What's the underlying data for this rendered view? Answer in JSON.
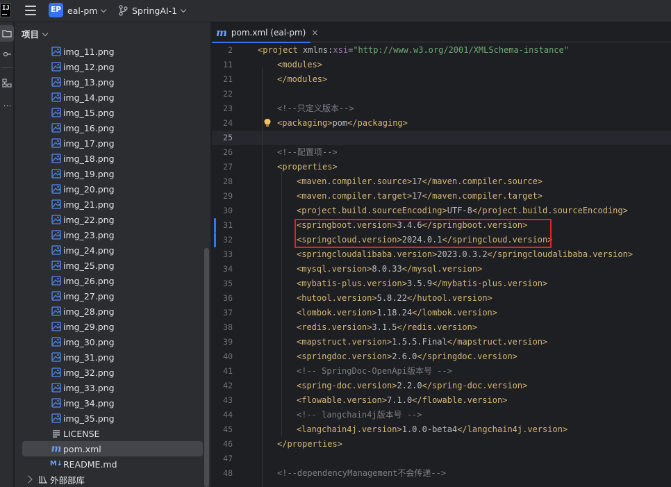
{
  "titlebar": {
    "logo_text": "IJ",
    "project_badge": "EP",
    "project_name": "eal-pm",
    "branch_name": "SpringAI-1"
  },
  "project_panel": {
    "header": "项目",
    "items": [
      {
        "label": "img_11.png",
        "type": "image"
      },
      {
        "label": "img_12.png",
        "type": "image"
      },
      {
        "label": "img_13.png",
        "type": "image"
      },
      {
        "label": "img_14.png",
        "type": "image"
      },
      {
        "label": "img_15.png",
        "type": "image"
      },
      {
        "label": "img_16.png",
        "type": "image"
      },
      {
        "label": "img_17.png",
        "type": "image"
      },
      {
        "label": "img_18.png",
        "type": "image"
      },
      {
        "label": "img_19.png",
        "type": "image"
      },
      {
        "label": "img_20.png",
        "type": "image"
      },
      {
        "label": "img_21.png",
        "type": "image"
      },
      {
        "label": "img_22.png",
        "type": "image"
      },
      {
        "label": "img_23.png",
        "type": "image"
      },
      {
        "label": "img_24.png",
        "type": "image"
      },
      {
        "label": "img_25.png",
        "type": "image"
      },
      {
        "label": "img_26.png",
        "type": "image"
      },
      {
        "label": "img_27.png",
        "type": "image"
      },
      {
        "label": "img_28.png",
        "type": "image"
      },
      {
        "label": "img_29.png",
        "type": "image"
      },
      {
        "label": "img_30.png",
        "type": "image"
      },
      {
        "label": "img_31.png",
        "type": "image"
      },
      {
        "label": "img_32.png",
        "type": "image"
      },
      {
        "label": "img_33.png",
        "type": "image"
      },
      {
        "label": "img_34.png",
        "type": "image"
      },
      {
        "label": "img_35.png",
        "type": "image"
      },
      {
        "label": "LICENSE",
        "type": "text"
      },
      {
        "label": "pom.xml",
        "type": "maven",
        "selected": true
      },
      {
        "label": "README.md",
        "type": "markdown"
      }
    ],
    "external_libraries": "外部部库"
  },
  "editor": {
    "tab_label": "pom.xml (eal-pm)",
    "tab_close": "×",
    "lines": [
      {
        "num": "2",
        "parts": [
          [
            "tag",
            "<project "
          ],
          [
            "attr",
            "xmlns:"
          ],
          [
            "ns",
            "xsi"
          ],
          [
            "attr",
            "="
          ],
          [
            "str",
            "\"http://www.w3.org/2001/XMLSchema-instance\""
          ]
        ],
        "indent": 0
      },
      {
        "num": "11",
        "parts": [
          [
            "tag",
            "<modules>"
          ]
        ],
        "indent": 1
      },
      {
        "num": "21",
        "parts": [
          [
            "tag",
            "</modules>"
          ]
        ],
        "indent": 1
      },
      {
        "num": "22",
        "parts": [],
        "indent": 0
      },
      {
        "num": "23",
        "parts": [
          [
            "cmt",
            "<!--只定义版本-->"
          ]
        ],
        "indent": 1
      },
      {
        "num": "24",
        "parts": [
          [
            "tag",
            "<packaging>"
          ],
          [
            "txt",
            "pom"
          ],
          [
            "tag",
            "</packaging>"
          ]
        ],
        "indent": 1,
        "bulb": true
      },
      {
        "num": "25",
        "parts": [],
        "indent": 0,
        "current": true
      },
      {
        "num": "26",
        "parts": [
          [
            "cmt",
            "<!--配置项-->"
          ]
        ],
        "indent": 1
      },
      {
        "num": "27",
        "parts": [
          [
            "tag",
            "<properties>"
          ]
        ],
        "indent": 1
      },
      {
        "num": "28",
        "parts": [
          [
            "tag",
            "<maven.compiler.source>"
          ],
          [
            "txt",
            "17"
          ],
          [
            "tag",
            "</maven.compiler.source>"
          ]
        ],
        "indent": 2
      },
      {
        "num": "29",
        "parts": [
          [
            "tag",
            "<maven.compiler.target>"
          ],
          [
            "txt",
            "17"
          ],
          [
            "tag",
            "</maven.compiler.target>"
          ]
        ],
        "indent": 2
      },
      {
        "num": "30",
        "parts": [
          [
            "tag",
            "<project.build.sourceEncoding>"
          ],
          [
            "txt",
            "UTF-8"
          ],
          [
            "tag",
            "</project.build.sourceEncoding>"
          ]
        ],
        "indent": 2
      },
      {
        "num": "31",
        "parts": [
          [
            "tag",
            "<springboot.version>"
          ],
          [
            "txt",
            "3.4.6"
          ],
          [
            "tag",
            "</springboot.version>"
          ]
        ],
        "indent": 2,
        "changed": true
      },
      {
        "num": "32",
        "parts": [
          [
            "tag",
            "<springcloud.version>"
          ],
          [
            "txt",
            "2024.0.1"
          ],
          [
            "tag",
            "</springcloud.version>"
          ]
        ],
        "indent": 2,
        "changed": true
      },
      {
        "num": "33",
        "parts": [
          [
            "tag",
            "<springcloudalibaba.version>"
          ],
          [
            "txt",
            "2023.0.3.2"
          ],
          [
            "tag",
            "</springcloudalibaba.version>"
          ]
        ],
        "indent": 2
      },
      {
        "num": "34",
        "parts": [
          [
            "tag",
            "<mysql.version>"
          ],
          [
            "txt",
            "8.0.33"
          ],
          [
            "tag",
            "</mysql.version>"
          ]
        ],
        "indent": 2
      },
      {
        "num": "35",
        "parts": [
          [
            "tag",
            "<mybatis-plus.version>"
          ],
          [
            "txt",
            "3.5.9"
          ],
          [
            "tag",
            "</mybatis-plus.version>"
          ]
        ],
        "indent": 2
      },
      {
        "num": "36",
        "parts": [
          [
            "tag",
            "<hutool.version>"
          ],
          [
            "txt",
            "5.8.22"
          ],
          [
            "tag",
            "</hutool.version>"
          ]
        ],
        "indent": 2
      },
      {
        "num": "37",
        "parts": [
          [
            "tag",
            "<lombok.version>"
          ],
          [
            "txt",
            "1.18.24"
          ],
          [
            "tag",
            "</lombok.version>"
          ]
        ],
        "indent": 2
      },
      {
        "num": "38",
        "parts": [
          [
            "tag",
            "<redis.version>"
          ],
          [
            "txt",
            "3.1.5"
          ],
          [
            "tag",
            "</redis.version>"
          ]
        ],
        "indent": 2
      },
      {
        "num": "39",
        "parts": [
          [
            "tag",
            "<mapstruct.version>"
          ],
          [
            "txt",
            "1.5.5.Final"
          ],
          [
            "tag",
            "</mapstruct.version>"
          ]
        ],
        "indent": 2
      },
      {
        "num": "40",
        "parts": [
          [
            "tag",
            "<springdoc.version>"
          ],
          [
            "txt",
            "2.6.0"
          ],
          [
            "tag",
            "</springdoc.version>"
          ]
        ],
        "indent": 2
      },
      {
        "num": "41",
        "parts": [
          [
            "cmt",
            "<!-- SpringDoc-OpenApi版本号 -->"
          ]
        ],
        "indent": 2
      },
      {
        "num": "42",
        "parts": [
          [
            "tag",
            "<spring-doc.version>"
          ],
          [
            "txt",
            "2.2.0"
          ],
          [
            "tag",
            "</spring-doc.version>"
          ]
        ],
        "indent": 2
      },
      {
        "num": "43",
        "parts": [
          [
            "tag",
            "<flowable.version>"
          ],
          [
            "txt",
            "7.1.0"
          ],
          [
            "tag",
            "</flowable.version>"
          ]
        ],
        "indent": 2
      },
      {
        "num": "44",
        "parts": [
          [
            "cmt",
            "<!-- langchain4j版本号 -->"
          ]
        ],
        "indent": 2
      },
      {
        "num": "45",
        "parts": [
          [
            "tag",
            "<langchain4j.version>"
          ],
          [
            "txt",
            "1.0.0-beta4"
          ],
          [
            "tag",
            "</langchain4j.version>"
          ]
        ],
        "indent": 2
      },
      {
        "num": "46",
        "parts": [
          [
            "tag",
            "</properties>"
          ]
        ],
        "indent": 1
      },
      {
        "num": "47",
        "parts": [],
        "indent": 0
      },
      {
        "num": "48",
        "parts": [
          [
            "cmt",
            "<!--dependencyManagement不会传递-->"
          ]
        ],
        "indent": 1
      }
    ]
  },
  "colors": {
    "accent": "#3574f0",
    "highlight_box": "#e3232c",
    "xml_tag": "#d5b778",
    "string": "#6aab73",
    "comment": "#7a7e85"
  }
}
